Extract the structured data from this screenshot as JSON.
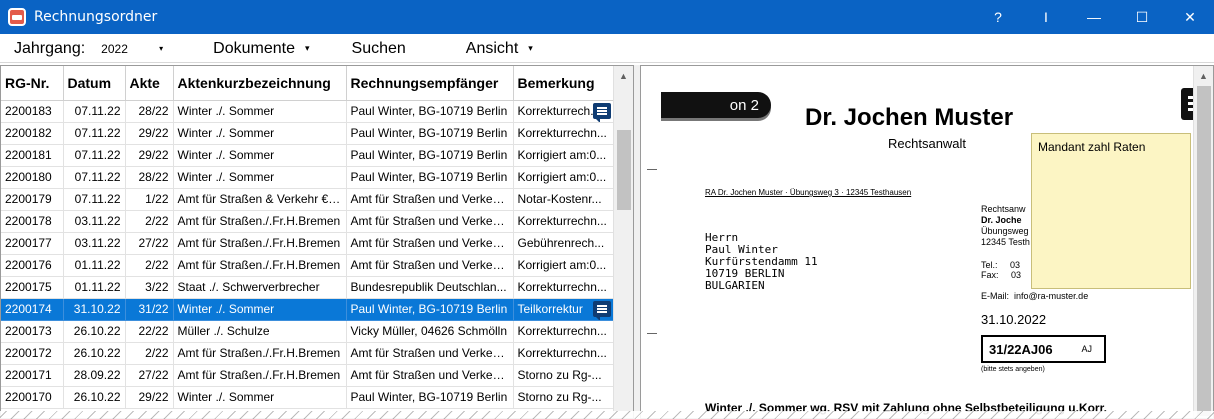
{
  "window": {
    "title": "Rechnungsordner",
    "controls": {
      "help": "?",
      "cursor": "I",
      "minimize": "—",
      "maximize": "☐",
      "close": "✕"
    }
  },
  "menubar": {
    "year_label": "Jahrgang:",
    "year_value": "2022",
    "menus": [
      "Dokumente",
      "Suchen",
      "Ansicht"
    ]
  },
  "table": {
    "columns": [
      "RG-Nr.",
      "Datum",
      "Akte",
      "Aktenkurzbezeichnung",
      "Rechnungsempfänger",
      "Bemerkung"
    ],
    "rows": [
      {
        "nr": "2200183",
        "date": "07.11.22",
        "file": "28/22",
        "short": "Winter ./. Sommer",
        "recipient": "Paul Winter, BG-10719 Berlin",
        "note": "Korrekturrech...",
        "has_note_icon": true,
        "selected": false
      },
      {
        "nr": "2200182",
        "date": "07.11.22",
        "file": "29/22",
        "short": "Winter ./. Sommer",
        "recipient": "Paul Winter, BG-10719 Berlin",
        "note": "Korrekturrechn...",
        "has_note_icon": false,
        "selected": false
      },
      {
        "nr": "2200181",
        "date": "07.11.22",
        "file": "29/22",
        "short": "Winter ./. Sommer",
        "recipient": "Paul Winter, BG-10719 Berlin",
        "note": "Korrigiert am:0...",
        "has_note_icon": false,
        "selected": false
      },
      {
        "nr": "2200180",
        "date": "07.11.22",
        "file": "28/22",
        "short": "Winter ./. Sommer",
        "recipient": "Paul Winter, BG-10719 Berlin",
        "note": "Korrigiert am:0...",
        "has_note_icon": false,
        "selected": false
      },
      {
        "nr": "2200179",
        "date": "07.11.22",
        "file": "1/22",
        "short": "Amt für Straßen & Verkehr €ÄÜ",
        "recipient": "Amt für Straßen und Verkehr...",
        "note": "Notar-Kostenr...",
        "has_note_icon": false,
        "selected": false
      },
      {
        "nr": "2200178",
        "date": "03.11.22",
        "file": "2/22",
        "short": "Amt für Straßen./.Fr.H.Bremen",
        "recipient": "Amt für Straßen und Verkehr...",
        "note": "Korrekturrechn...",
        "has_note_icon": false,
        "selected": false
      },
      {
        "nr": "2200177",
        "date": "03.11.22",
        "file": "27/22",
        "short": "Amt für Straßen./.Fr.H.Bremen",
        "recipient": "Amt für Straßen und Verkehr...",
        "note": "Gebührenrech...",
        "has_note_icon": false,
        "selected": false
      },
      {
        "nr": "2200176",
        "date": "01.11.22",
        "file": "2/22",
        "short": "Amt für Straßen./.Fr.H.Bremen",
        "recipient": "Amt für Straßen und Verkehr...",
        "note": "Korrigiert am:0...",
        "has_note_icon": false,
        "selected": false
      },
      {
        "nr": "2200175",
        "date": "01.11.22",
        "file": "3/22",
        "short": "Staat ./. Schwerverbrecher",
        "recipient": "Bundesrepublik Deutschlan...",
        "note": "Korrekturrechn...",
        "has_note_icon": false,
        "selected": false
      },
      {
        "nr": "2200174",
        "date": "31.10.22",
        "file": "31/22",
        "short": "Winter ./. Sommer",
        "recipient": "Paul Winter, BG-10719 Berlin",
        "note": "Teilkorrektur",
        "has_note_icon": true,
        "selected": true
      },
      {
        "nr": "2200173",
        "date": "26.10.22",
        "file": "22/22",
        "short": "Müller ./. Schulze",
        "recipient": "Vicky Müller, 04626 Schmölln",
        "note": "Korrekturrechn...",
        "has_note_icon": false,
        "selected": false
      },
      {
        "nr": "2200172",
        "date": "26.10.22",
        "file": "2/22",
        "short": "Amt für Straßen./.Fr.H.Bremen",
        "recipient": "Amt für Straßen und Verkehr...",
        "note": "Korrekturrechn...",
        "has_note_icon": false,
        "selected": false
      },
      {
        "nr": "2200171",
        "date": "28.09.22",
        "file": "27/22",
        "short": "Amt für Straßen./.Fr.H.Bremen",
        "recipient": "Amt für Straßen und Verkehr...",
        "note": "Storno zu Rg-...",
        "has_note_icon": false,
        "selected": false
      },
      {
        "nr": "2200170",
        "date": "26.10.22",
        "file": "29/22",
        "short": "Winter ./. Sommer",
        "recipient": "Paul Winter, BG-10719 Berlin",
        "note": "Storno zu Rg-...",
        "has_note_icon": false,
        "selected": false
      }
    ]
  },
  "preview": {
    "page_label": "on 2",
    "lawyer_name": "Dr. Jochen Muster",
    "lawyer_title": "Rechtsanwalt",
    "sender_line": "RA Dr. Jochen Muster · Übungsweg 3 · 12345 Testhausen",
    "address": [
      "Herrn",
      "Paul Winter",
      "Kurfürstendamm 11",
      "10719 BERLIN",
      "BULGARIEN"
    ],
    "right_col": {
      "role": "Rechtsanw",
      "name": "Dr. Joche",
      "street": "Übungsweg",
      "city": "12345 Testh",
      "tel_label": "Tel.:",
      "tel_value": "03",
      "fax_label": "Fax:",
      "fax_value": "03",
      "email_label": "E-Mail:",
      "email_value": "info@ra-muster.de"
    },
    "date": "31.10.2022",
    "file_number": "31/22AJ06",
    "file_initials": "AJ",
    "file_hint": "(bitte stets angeben)",
    "subject": "Winter ./. Sommer wg. RSV mit Zahlung ohne Selbstbeteiligung u.Korr.",
    "sticky_note": "Mandant zahl Raten"
  }
}
